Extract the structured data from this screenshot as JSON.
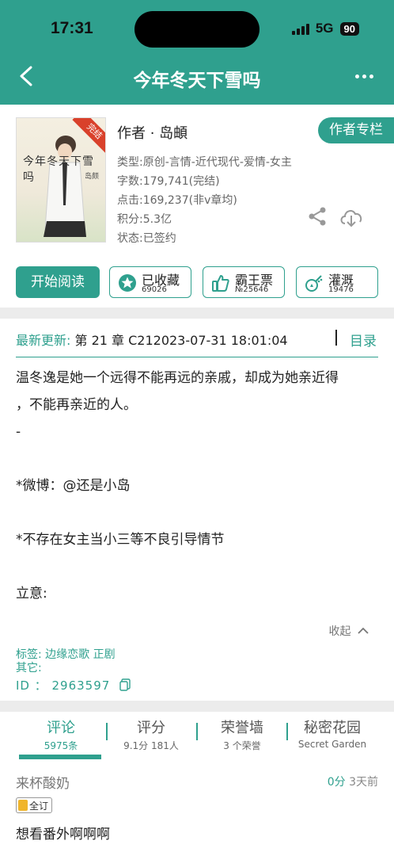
{
  "status_bar": {
    "time": "17:31",
    "network": "5G",
    "battery": "90"
  },
  "header": {
    "title": "今年冬天下雪吗"
  },
  "book": {
    "cover_title": "今年冬天下雪吗",
    "cover_author": "岛颇",
    "cover_ribbon": "完结",
    "author_line": "作者 · 岛頔",
    "author_column_button": "作者专栏",
    "type": "类型:原创-言情-近代现代-爱情-女主",
    "words": "字数:179,741(完结)",
    "clicks": "点击:169,237(非v章均)",
    "score": "积分:5.3亿",
    "status": "状态:已签约"
  },
  "actions": {
    "read": "开始阅读",
    "collect": {
      "label": "已收藏",
      "sub": "69026"
    },
    "vote": {
      "label": "霸王票",
      "sub": "№25646"
    },
    "water": {
      "label": "灌溉",
      "sub": "19476"
    }
  },
  "summary": {
    "latest_label": "最新更新:",
    "latest_value": " 第 21 章 C212023-07-31 18:01:04",
    "toc": "目录",
    "lines": [
      "温冬逸是她一个远得不能再远的亲戚，却成为她亲近得",
      "，不能再亲近的人。",
      "-",
      "",
      "*微博：@还是小岛",
      "",
      "*不存在女主当小三等不良引导情节",
      "",
      "立意:"
    ],
    "collapse": "收起",
    "tags": "标签: 边缘恋歌  正剧",
    "other": "其它:",
    "id": "ID  ：  2963597"
  },
  "comments": {
    "tabs": [
      {
        "label": "评论",
        "sub": "5975条"
      },
      {
        "label": "评分",
        "sub": "9.1分 181人"
      },
      {
        "label": "荣誉墙",
        "sub": "3 个荣誉"
      },
      {
        "label": "秘密花园",
        "sub": "Secret Garden"
      }
    ],
    "item": {
      "user": "来杯酸奶",
      "score": "0分",
      "time": "3天前",
      "badge": "全订",
      "text": "想看番外啊啊啊"
    }
  },
  "colors": {
    "accent": "#2fa08e",
    "ribbon": "#d9412b"
  }
}
